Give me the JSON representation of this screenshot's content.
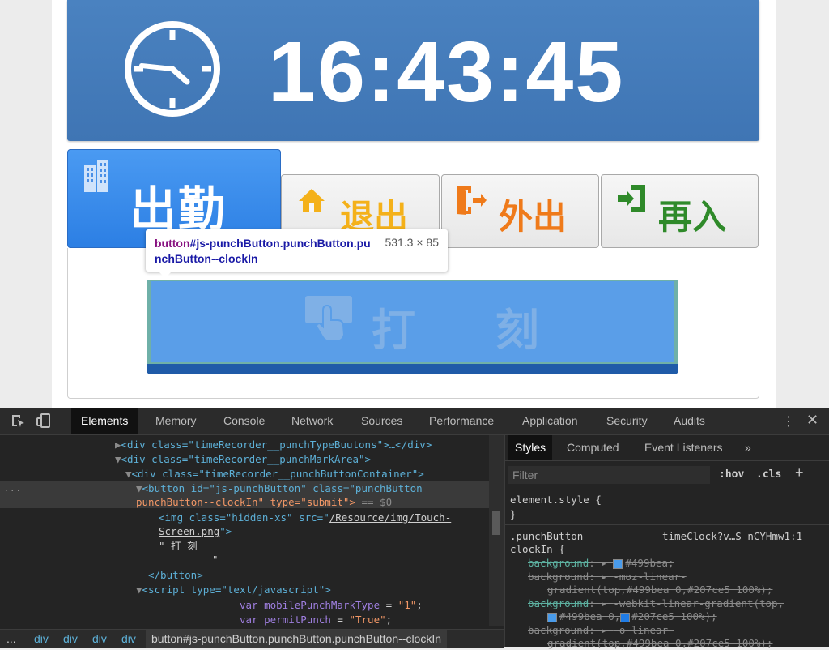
{
  "clock": {
    "time": "16:43:45"
  },
  "punch_types": [
    {
      "label": "出勤",
      "active": true
    },
    {
      "label": "退出"
    },
    {
      "label": "外出"
    },
    {
      "label": "再入"
    }
  ],
  "punch_button": {
    "label": "打 刻"
  },
  "tooltip": {
    "tag": "button",
    "selector": "#js-punchButton.punchButton.punchButton--clockIn",
    "size": "531.3 × 85"
  },
  "devtools": {
    "tabs": [
      "Elements",
      "Memory",
      "Console",
      "Network",
      "Sources",
      "Performance",
      "Application",
      "Security",
      "Audits"
    ],
    "active_tab": "Elements",
    "dom_lines": {
      "l1": "<div class=\"timeRecorder__punchTypeBuutons\">…</div>",
      "l2": "<div class=\"timeRecorder__punchMarkArea\">",
      "l3": "<div class=\"timeRecorder__punchButtonContainer\">",
      "l4a": "<button id=\"js-punchButton\" class=\"punchButton",
      "l4b": "punchButton--clockIn\" type=\"submit\">",
      "l4c": " == $0",
      "l5a": "<img class=\"hidden-xs\" src=\"",
      "l5b": "/Resource/img/Touch-",
      "l6a": "Screen.png",
      "l6b": "\">",
      "l7": "\" 打 刻",
      "l8": "\"",
      "l9": "</button>",
      "l10": "<script type=\"text/javascript\">",
      "l11a": "var ",
      "l11b": "mobilePunchMarkType",
      "l11c": " = ",
      "l11d": "\"1\"",
      "l12a": "var ",
      "l12b": "permitPunch",
      "l12c": " = ",
      "l12d": "\"True\""
    },
    "breadcrumbs": [
      "...",
      "div",
      "div",
      "div",
      "div",
      "button#js-punchButton.punchButton.punchButton--clockIn"
    ],
    "styles": {
      "tabs": [
        "Styles",
        "Computed",
        "Event Listeners",
        "»"
      ],
      "filter_placeholder": "Filter",
      "hov": ":hov",
      "cls": ".cls",
      "element_style": "element.style {",
      "close_brace": "}",
      "rule_selector_1": ".punchButton--",
      "rule_selector_2": "clockIn {",
      "rule_source": "timeClock?v…S-nCYHmw1:1",
      "decls": [
        {
          "prop": "background",
          "value": "#499bea;"
        },
        {
          "prop": "background",
          "value": "-moz-linear-",
          "value2": "gradient(top,#499bea 0,#207ce5 100%);"
        },
        {
          "prop": "background",
          "value": "-webkit-linear-gradient(top,",
          "value2": "#499bea 0,",
          "value3": "#207ce5 100%);"
        },
        {
          "prop": "background",
          "value": "-o-linear-",
          "value2": "gradient(top,#499bea 0,#207ce5 100%);"
        }
      ]
    }
  }
}
